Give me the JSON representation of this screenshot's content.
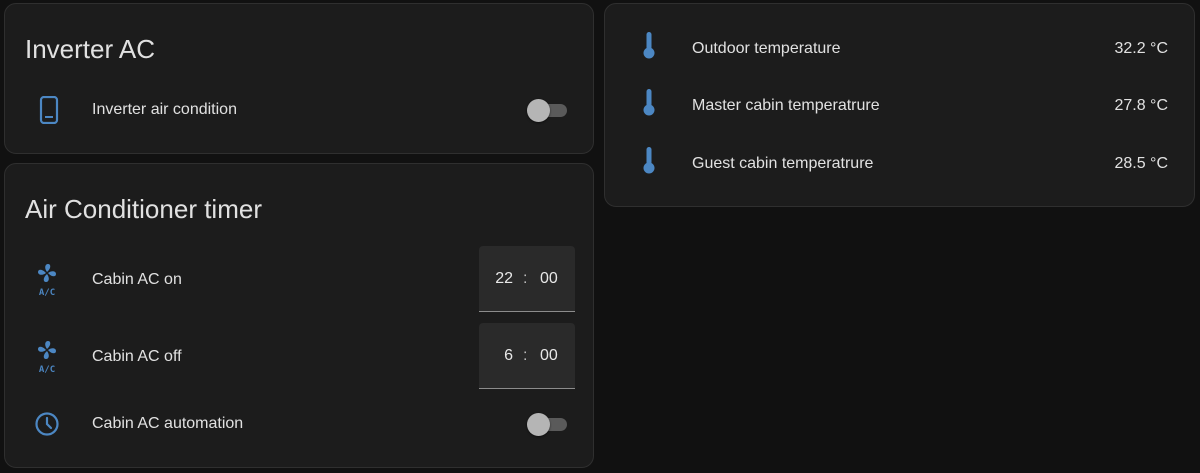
{
  "colors": {
    "background": "#111111",
    "card": "#1c1c1c",
    "icon_accent": "#4c87c3",
    "text": "#e1e1e1"
  },
  "inverter_card": {
    "title": "Inverter AC",
    "rows": [
      {
        "label": "Inverter air condition",
        "icon": "tablet-icon",
        "toggle_on": false
      }
    ]
  },
  "timer_card": {
    "title": "Air Conditioner timer",
    "ac_on": {
      "label": "Cabin AC on",
      "icon": "air-conditioner-icon",
      "hour": "22",
      "separator": ":",
      "minute": "00"
    },
    "ac_off": {
      "label": "Cabin AC off",
      "icon": "air-conditioner-icon",
      "hour": "6",
      "separator": ":",
      "minute": "00"
    },
    "automation": {
      "label": "Cabin AC automation",
      "icon": "clock-icon",
      "toggle_on": false
    }
  },
  "sensors_card": {
    "rows": [
      {
        "label": "Outdoor temperature",
        "value": "32.2 °C",
        "icon": "thermometer-icon"
      },
      {
        "label": "Master cabin temperatrure",
        "value": "27.8 °C",
        "icon": "thermometer-icon"
      },
      {
        "label": "Guest cabin temperatrure",
        "value": "28.5 °C",
        "icon": "thermometer-icon"
      }
    ]
  }
}
